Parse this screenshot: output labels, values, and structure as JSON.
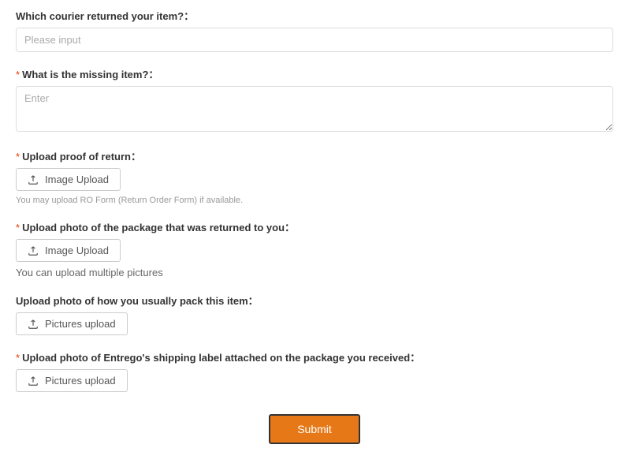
{
  "courier": {
    "label": "Which courier returned your item?：",
    "placeholder": "Please input",
    "required": false
  },
  "missing_item": {
    "label": "What is the missing item?：",
    "placeholder": "Enter",
    "required": true
  },
  "proof_of_return": {
    "label": "Upload proof of return：",
    "button": "Image Upload",
    "hint": "You may upload RO Form (Return Order Form) if available.",
    "required": true
  },
  "package_photo": {
    "label": "Upload photo of the package that was returned to you：",
    "button": "Image Upload",
    "hint": "You can upload multiple pictures",
    "required": true
  },
  "pack_photo": {
    "label": "Upload photo of how you usually pack this item：",
    "button": "Pictures upload",
    "required": false
  },
  "shipping_label_photo": {
    "label": "Upload photo of Entrego's shipping label attached on the package you received：",
    "button": "Pictures upload",
    "required": true
  },
  "submit": {
    "label": "Submit"
  },
  "required_mark": "*"
}
